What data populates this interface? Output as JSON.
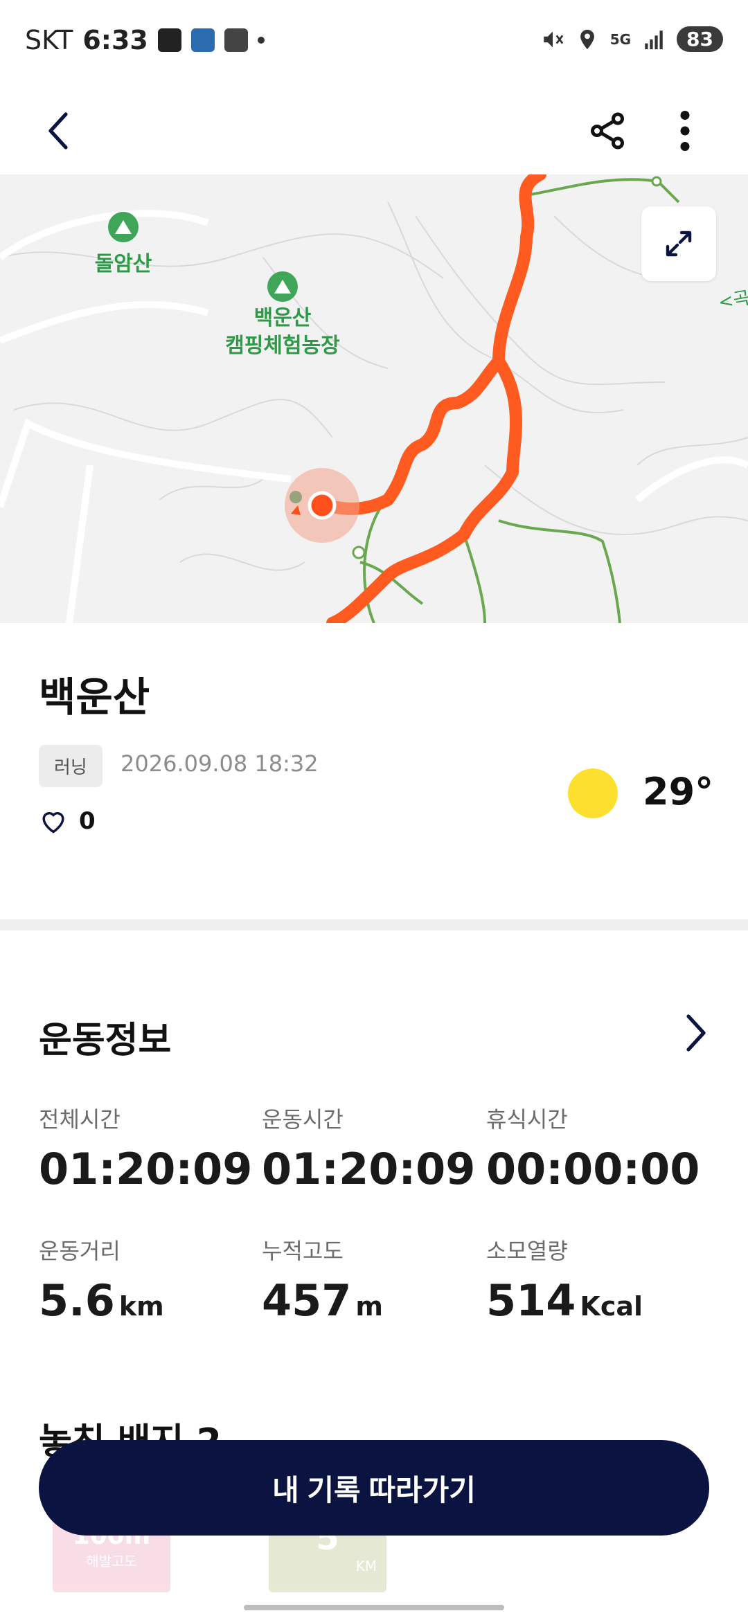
{
  "status_bar": {
    "carrier": "SKT",
    "time": "6:33",
    "battery": "83",
    "network": "5G"
  },
  "app_bar": {
    "back_icon": "chevron-left-icon",
    "share_icon": "share-icon",
    "more_icon": "more-vert-icon"
  },
  "map": {
    "labels": {
      "peak1": "돌암산",
      "peak2_line1": "백운산",
      "peak2_line2": "캠핑체험농장",
      "edge": "<곡"
    },
    "expand_icon": "expand-icon",
    "route_color": "#ff5a1f",
    "trail_color": "#6aa84f"
  },
  "activity": {
    "title": "백운산",
    "type": "러닝",
    "datetime": "2026.09.08 18:32",
    "likes": "0",
    "temperature": "29°"
  },
  "stats": {
    "section_title": "운동정보",
    "items": [
      {
        "label": "전체시간",
        "value": "01:20:09",
        "unit": ""
      },
      {
        "label": "운동시간",
        "value": "01:20:09",
        "unit": ""
      },
      {
        "label": "휴식시간",
        "value": "00:00:00",
        "unit": ""
      },
      {
        "label": "운동거리",
        "value": "5.6",
        "unit": "km"
      },
      {
        "label": "누적고도",
        "value": "457",
        "unit": "m"
      },
      {
        "label": "소모열량",
        "value": "514",
        "unit": "Kcal"
      }
    ]
  },
  "badges": {
    "section_title": "놓친 배지 2",
    "items": [
      {
        "text": "100m",
        "sub": "해발고도"
      },
      {
        "text": "5",
        "sub": "KM"
      }
    ]
  },
  "cta": {
    "label": "내 기록 따라가기"
  }
}
